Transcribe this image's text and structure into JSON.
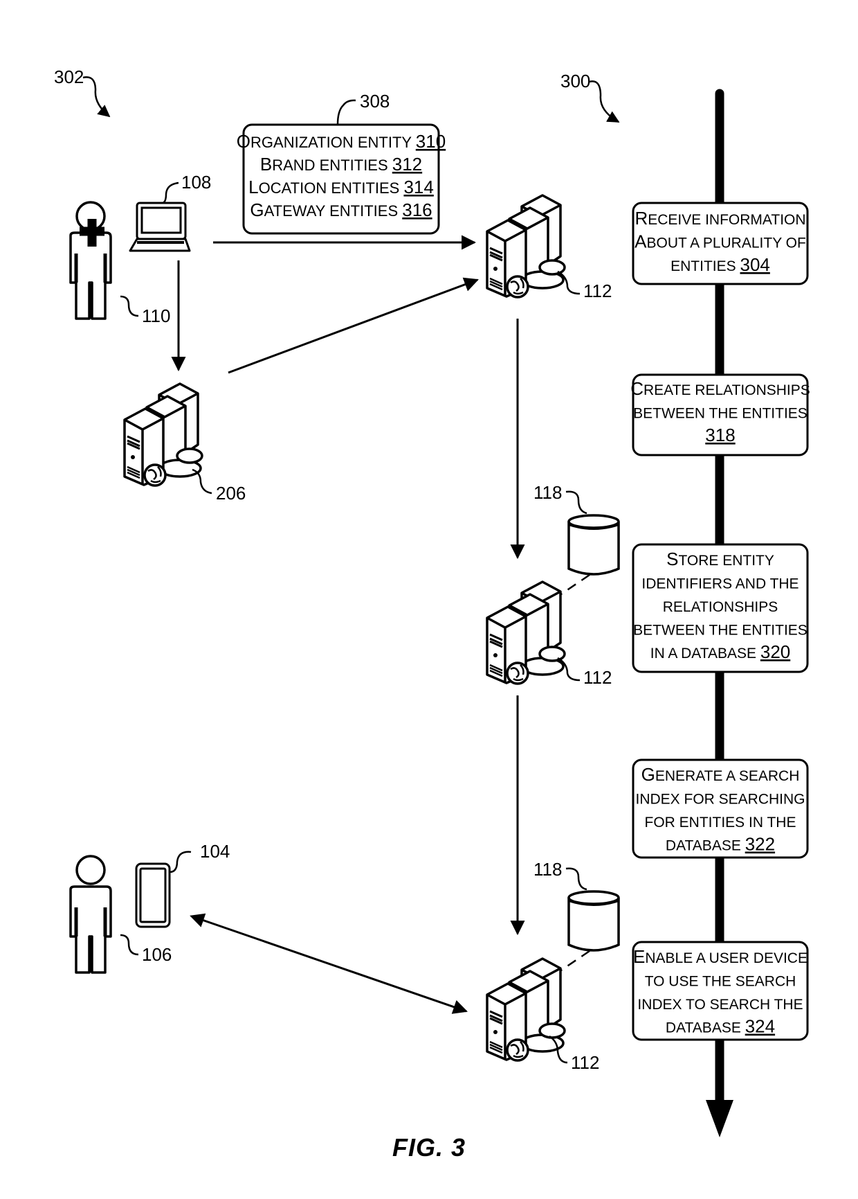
{
  "figure": {
    "caption": "FIG. 3",
    "left_group_ref": "302",
    "process_ref": "300"
  },
  "entities_box": {
    "ref": "308",
    "lines": [
      {
        "cap": "O",
        "rest": "RGANIZATION ENTITY",
        "num": "310"
      },
      {
        "cap": "B",
        "rest": "RAND ENTITIES",
        "num": "312"
      },
      {
        "cap": "L",
        "rest": "OCATION ENTITIES",
        "num": "314"
      },
      {
        "cap": "G",
        "rest": "ATEWAY ENTITIES",
        "num": "316"
      }
    ]
  },
  "actors": {
    "admin_user_ref": "110",
    "laptop_ref": "108",
    "gateway_server_ref": "206",
    "end_user_ref": "106",
    "mobile_device_ref": "104"
  },
  "servers": [
    {
      "ref": "112"
    },
    {
      "ref": "112",
      "database_ref": "118"
    },
    {
      "ref": "112",
      "database_ref": "118"
    }
  ],
  "steps": [
    {
      "lines": [
        [
          "R",
          "ECEIVE INFORMATION"
        ],
        [
          "A",
          "BOUT A PLURALITY OF"
        ],
        [
          "",
          "ENTITIES "
        ]
      ],
      "num": "304"
    },
    {
      "lines": [
        [
          "C",
          "REATE RELATIONSHIPS"
        ],
        [
          "",
          "BETWEEN THE ENTITIES"
        ],
        [
          "",
          ""
        ]
      ],
      "num": "318"
    },
    {
      "lines": [
        [
          "S",
          "TORE ENTITY"
        ],
        [
          "",
          "IDENTIFIERS AND THE"
        ],
        [
          "",
          "RELATIONSHIPS"
        ],
        [
          "",
          "BETWEEN THE ENTITIES"
        ],
        [
          "",
          "IN A DATABASE "
        ]
      ],
      "num": "320"
    },
    {
      "lines": [
        [
          "G",
          "ENERATE A SEARCH"
        ],
        [
          "",
          "INDEX FOR SEARCHING"
        ],
        [
          "",
          "FOR ENTITIES IN THE"
        ],
        [
          "",
          "DATABASE "
        ]
      ],
      "num": "322"
    },
    {
      "lines": [
        [
          "E",
          "NABLE A USER DEVICE"
        ],
        [
          "",
          "TO USE THE SEARCH"
        ],
        [
          "",
          "INDEX TO SEARCH THE"
        ],
        [
          "",
          "DATABASE "
        ]
      ],
      "num": "324"
    }
  ]
}
